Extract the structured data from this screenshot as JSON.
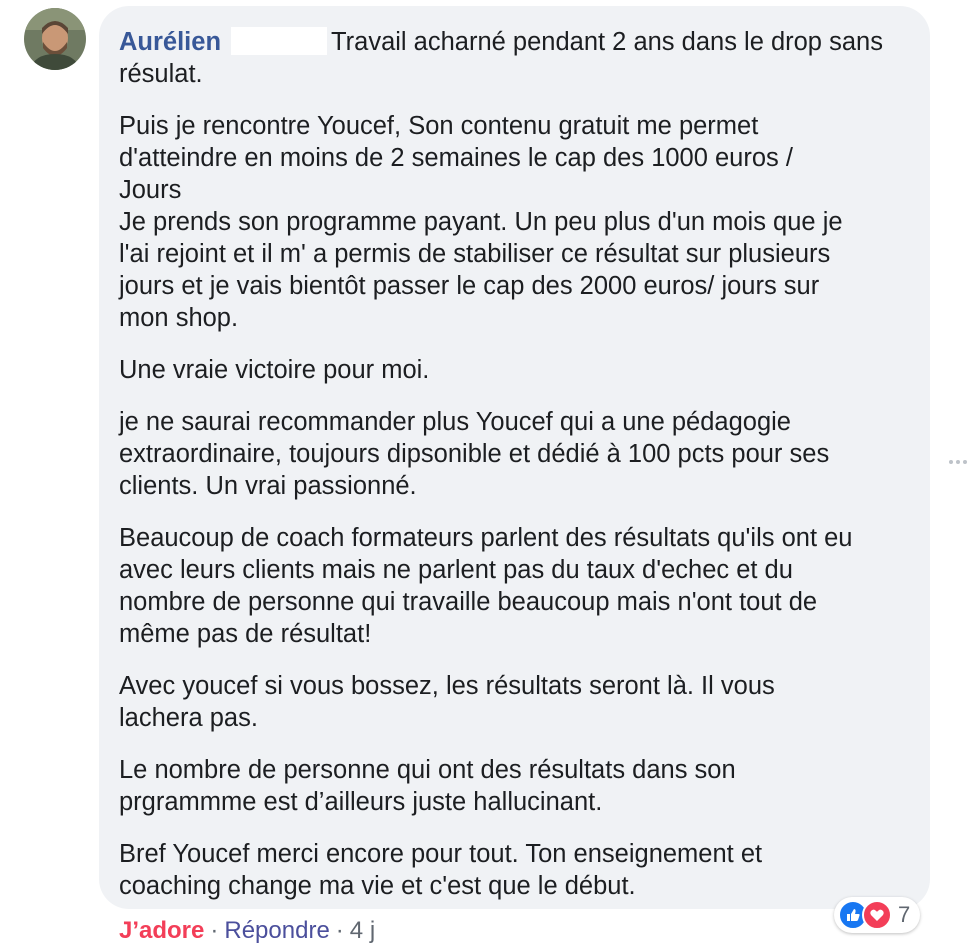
{
  "comment": {
    "author": "Aurélien",
    "first_line_text": "Travail acharné pendant 2 ans dans le drop sans résulat.",
    "paragraphs": [
      "Puis je rencontre Youcef, Son contenu gratuit me permet\nd'atteindre en moins de 2 semaines le cap des 1000 euros /\nJours\nJe prends son programme payant. Un peu plus d'un mois que je\nl'ai rejoint et il m' a permis de stabiliser ce résultat sur plusieurs\njours et je vais bientôt passer le cap des 2000 euros/ jours sur\nmon shop.",
      "Une vraie victoire pour moi.",
      "je ne saurai recommander plus Youcef qui a une pédagogie\nextraordinaire, toujours dipsonible et dédié à 100 pcts pour ses\nclients. Un vrai passionné.",
      "Beaucoup de coach formateurs parlent des résultats qu'ils ont eu\navec leurs clients mais ne parlent pas du taux d'echec et du\nnombre de personne qui travaille beaucoup mais n'ont tout de\nmême pas de résultat!",
      "Avec youcef si vous bossez, les résultats seront là. Il vous\nlachera pas.",
      "Le nombre de personne qui ont des résultats dans son\nprgrammme est d’ailleurs juste hallucinant.",
      "Bref Youcef merci encore pour tout. Ton enseignement et\ncoaching change ma vie et c'est que le début."
    ]
  },
  "actions": {
    "love_label": "J’adore",
    "separator": "·",
    "reply_label": "Répondre",
    "age": "4 j"
  },
  "reactions": {
    "count": "7",
    "icons": [
      "like-icon",
      "love-icon"
    ]
  },
  "colors": {
    "author": "#385898",
    "love": "#f33e58",
    "bubble": "#f0f2f5",
    "like": "#1877f2"
  }
}
